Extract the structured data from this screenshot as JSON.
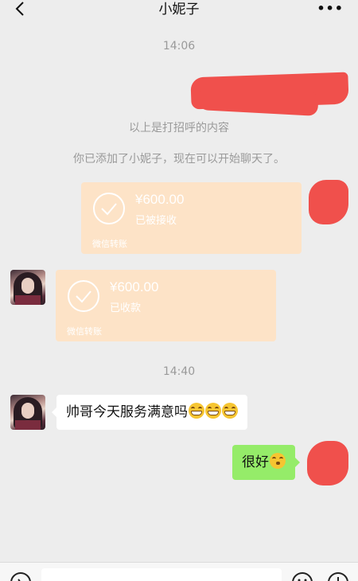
{
  "header": {
    "title": "小妮子",
    "back_icon": "chevron-left-icon",
    "more_label": "•••"
  },
  "messages": {
    "time_1": "14:06",
    "system_greeting": "以上是打招呼的内容",
    "system_added": "你已添加了小妮子，现在可以开始聊天了。",
    "transfer_sent": {
      "amount": "¥600.00",
      "status": "已被接收",
      "label": "微信转账"
    },
    "transfer_received": {
      "amount": "¥600.00",
      "status": "已收款",
      "label": "微信转账"
    },
    "time_2": "14:40",
    "incoming_text": "帅哥今天服务满意吗",
    "outgoing_text": "很好"
  },
  "colors": {
    "background": "#ededed",
    "transfer_card": "#fde3c7",
    "outgoing_bubble": "#95ec69",
    "incoming_bubble": "#ffffff",
    "redaction": "#f0504c"
  }
}
